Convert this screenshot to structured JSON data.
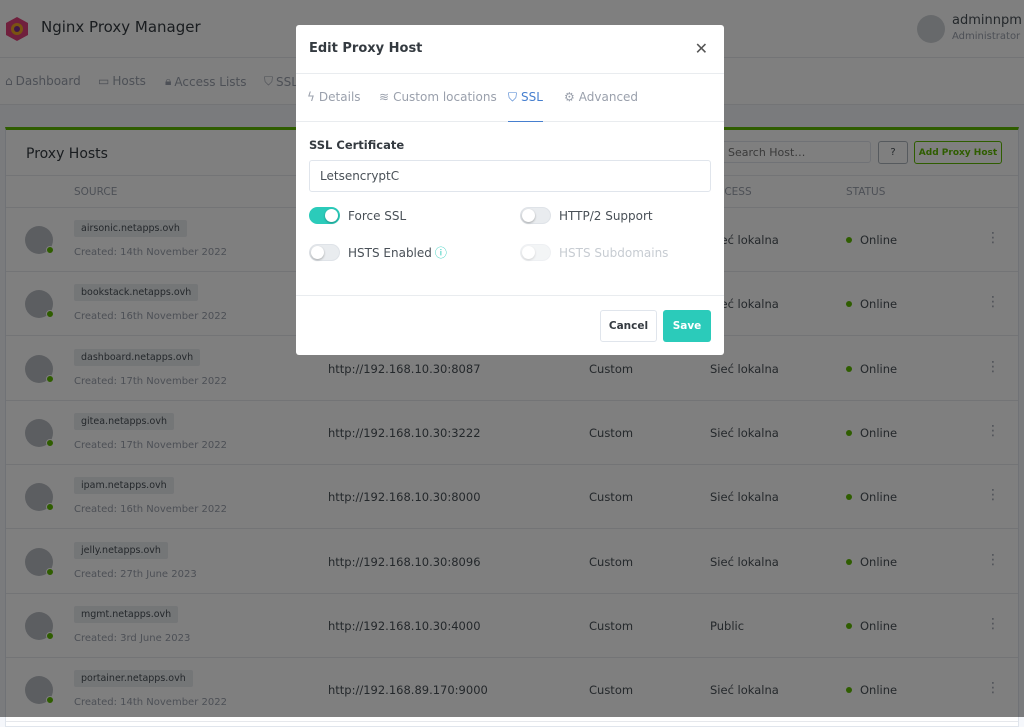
{
  "app": {
    "title": "Nginx Proxy Manager"
  },
  "user": {
    "name": "adminnpm",
    "role": "Administrator"
  },
  "nav": [
    {
      "label": "Dashboard",
      "icon": "home-icon"
    },
    {
      "label": "Hosts",
      "icon": "monitor-icon"
    },
    {
      "label": "Access Lists",
      "icon": "lock-icon"
    },
    {
      "label": "SSL",
      "icon": "shield-icon"
    }
  ],
  "card": {
    "title": "Proxy Hosts",
    "search_placeholder": "Search Host…",
    "help_label": "?",
    "add_label": "Add Proxy Host"
  },
  "columns": {
    "source": "SOURCE",
    "access": "ACCESS",
    "status": "STATUS"
  },
  "rows": [
    {
      "source": "airsonic.netapps.ovh",
      "created": "Created: 14th November 2022",
      "destination": "",
      "ssl": "",
      "access": "Sieć lokalna",
      "status": "Online"
    },
    {
      "source": "bookstack.netapps.ovh",
      "created": "Created: 16th November 2022",
      "destination": "",
      "ssl": "",
      "access": "Sieć lokalna",
      "status": "Online"
    },
    {
      "source": "dashboard.netapps.ovh",
      "created": "Created: 17th November 2022",
      "destination": "http://192.168.10.30:8087",
      "ssl": "Custom",
      "access": "Sieć lokalna",
      "status": "Online"
    },
    {
      "source": "gitea.netapps.ovh",
      "created": "Created: 17th November 2022",
      "destination": "http://192.168.10.30:3222",
      "ssl": "Custom",
      "access": "Sieć lokalna",
      "status": "Online"
    },
    {
      "source": "ipam.netapps.ovh",
      "created": "Created: 16th November 2022",
      "destination": "http://192.168.10.30:8000",
      "ssl": "Custom",
      "access": "Sieć lokalna",
      "status": "Online"
    },
    {
      "source": "jelly.netapps.ovh",
      "created": "Created: 27th June 2023",
      "destination": "http://192.168.10.30:8096",
      "ssl": "Custom",
      "access": "Sieć lokalna",
      "status": "Online"
    },
    {
      "source": "mgmt.netapps.ovh",
      "created": "Created: 3rd June 2023",
      "destination": "http://192.168.10.30:4000",
      "ssl": "Custom",
      "access": "Public",
      "status": "Online"
    },
    {
      "source": "portainer.netapps.ovh",
      "created": "Created: 14th November 2022",
      "destination": "http://192.168.89.170:9000",
      "ssl": "Custom",
      "access": "Sieć lokalna",
      "status": "Online"
    }
  ],
  "modal": {
    "title": "Edit Proxy Host",
    "tabs": [
      {
        "label": "Details"
      },
      {
        "label": "Custom locations"
      },
      {
        "label": "SSL",
        "active": true
      },
      {
        "label": "Advanced"
      }
    ],
    "ssl_label": "SSL Certificate",
    "ssl_value": "LetsencryptC",
    "toggles": {
      "force_ssl": {
        "label": "Force SSL",
        "on": true
      },
      "http2": {
        "label": "HTTP/2 Support",
        "on": false
      },
      "hsts": {
        "label": "HSTS Enabled",
        "on": false
      },
      "hsts_sub": {
        "label": "HSTS Subdomains",
        "on": false,
        "disabled": true
      }
    },
    "cancel": "Cancel",
    "save": "Save"
  },
  "colors": {
    "accent": "#2bcbba",
    "green": "#5eba00",
    "blue": "#467fcf"
  }
}
